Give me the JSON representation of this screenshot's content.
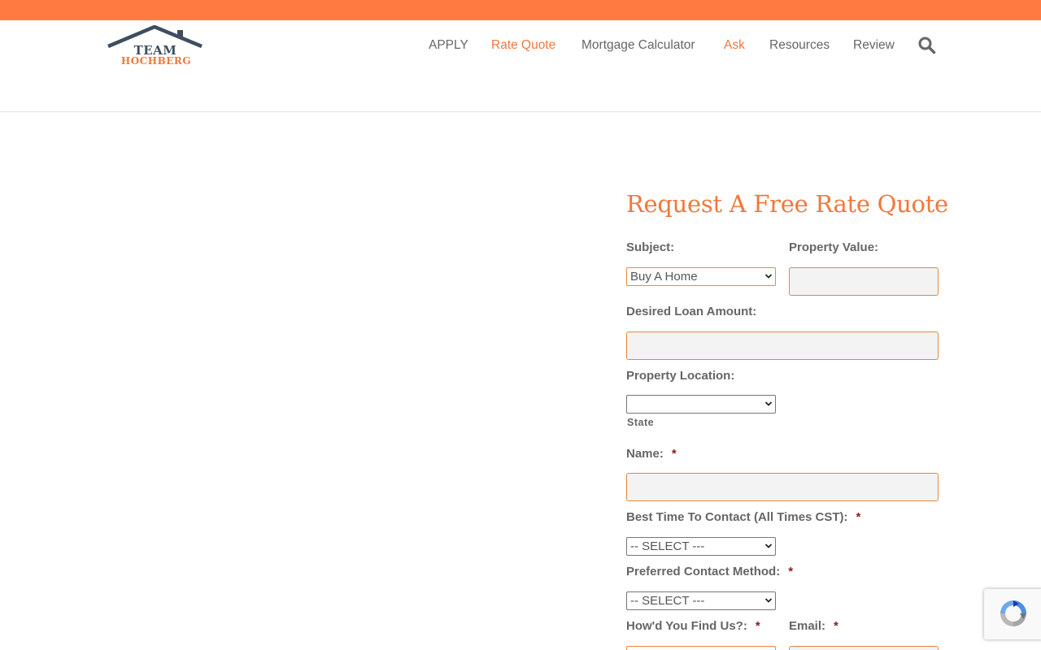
{
  "brand": {
    "logo_line1": "TEAM",
    "logo_line2": "HOCHBERG",
    "accent_color": "#ff7a40",
    "link_accent_color": "#f0783c"
  },
  "nav": {
    "items": [
      {
        "label": "APPLY",
        "accent": false
      },
      {
        "label": "Rate Quote",
        "accent": true
      },
      {
        "label": "Mortgage Calculator",
        "accent": false
      },
      {
        "label": "Ask",
        "accent": true
      },
      {
        "label": "Resources",
        "accent": false
      },
      {
        "label": "Review",
        "accent": false
      }
    ],
    "search_icon": "search-icon"
  },
  "form": {
    "title": "Request A Free Rate Quote",
    "subject_label": "Subject:",
    "subject_value": "Buy A Home",
    "property_value_label": "Property Value:",
    "property_value_value": "",
    "loan_amount_label": "Desired Loan Amount:",
    "loan_amount_value": "",
    "location_label": "Property Location:",
    "location_value": "",
    "state_label": "State",
    "name_label": "Name:",
    "name_value": "",
    "required_marker": "*",
    "best_time_label": "Best Time To Contact (All Times CST):",
    "best_time_value": "-- SELECT ---",
    "contact_method_label": "Preferred Contact Method:",
    "contact_method_value": "-- SELECT ---",
    "found_us_label": "How'd You Find Us?:",
    "email_label": "Email:"
  },
  "recaptcha": {
    "icon": "recaptcha-icon"
  }
}
